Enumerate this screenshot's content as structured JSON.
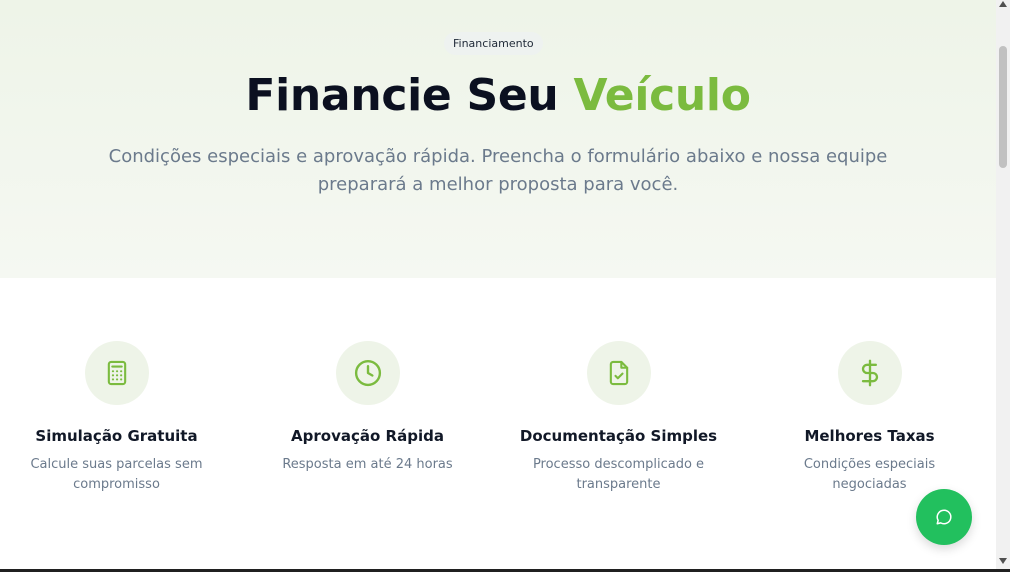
{
  "hero": {
    "badge": "Financiamento",
    "title_part1": "Financie Seu",
    "title_accent": "Veículo",
    "subtitle_line1": "Condições especiais e aprovação rápida. Preencha o formulário abaixo e nossa equipe",
    "subtitle_line2": "preparará a melhor proposta para você."
  },
  "features": [
    {
      "icon": "calculator-icon",
      "title": "Simulação Gratuita",
      "desc_line1": "Calcule suas parcelas sem",
      "desc_line2": "compromisso"
    },
    {
      "icon": "clock-icon",
      "title": "Aprovação Rápida",
      "desc_line1": "Resposta em até 24 horas",
      "desc_line2": ""
    },
    {
      "icon": "document-check-icon",
      "title": "Documentação Simples",
      "desc_line1": "Processo descomplicado e",
      "desc_line2": "transparente"
    },
    {
      "icon": "dollar-icon",
      "title": "Melhores Taxas",
      "desc_line1": "Condições especiais negociadas",
      "desc_line2": ""
    }
  ],
  "chat_button": {
    "icon": "chat-bubble-icon"
  },
  "colors": {
    "accent": "#7bbb3f",
    "chat": "#22c05e",
    "hero_bg": "#eef4e8",
    "text_muted": "#6b7a8c"
  }
}
